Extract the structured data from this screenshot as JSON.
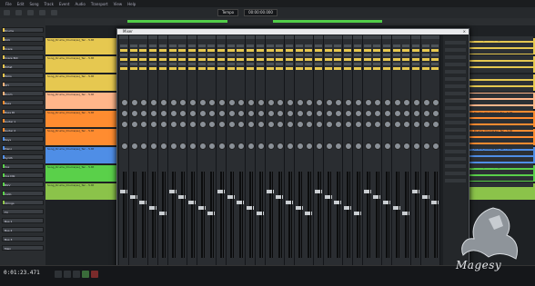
{
  "menu": {
    "items": [
      "File",
      "Edit",
      "Song",
      "Track",
      "Event",
      "Audio",
      "Transport",
      "View",
      "Help"
    ]
  },
  "toolbar": {
    "tempo_label": "Tempo",
    "time_display": "00:00:00.000"
  },
  "tracks": [
    {
      "name": "Drums",
      "color": "#e7c44c"
    },
    {
      "name": "Kick",
      "color": "#e7c44c"
    },
    {
      "name": "Snare",
      "color": "#e7c44c"
    },
    {
      "name": "Snare Bot",
      "color": "#e7c44c"
    },
    {
      "name": "HiHat",
      "color": "#e7c44c"
    },
    {
      "name": "Toms",
      "color": "#e7c44c"
    },
    {
      "name": "OH",
      "color": "#ffb07a"
    },
    {
      "name": "Room",
      "color": "#ffb07a"
    },
    {
      "name": "Bass",
      "color": "#ff8b2e"
    },
    {
      "name": "Bass DI",
      "color": "#ff8b2e"
    },
    {
      "name": "Guitar 1",
      "color": "#ff8b2e"
    },
    {
      "name": "Guitar 2",
      "color": "#ff8b2e"
    },
    {
      "name": "Keys",
      "color": "#4f8ee6"
    },
    {
      "name": "Piano",
      "color": "#4f8ee6"
    },
    {
      "name": "Synth",
      "color": "#4f8ee6"
    },
    {
      "name": "Vox",
      "color": "#5ad04a"
    },
    {
      "name": "Vox Dbl",
      "color": "#5ad04a"
    },
    {
      "name": "BGV",
      "color": "#5ad04a"
    },
    {
      "name": "Cello",
      "color": "#5ad04a"
    },
    {
      "name": "Strings",
      "color": "#8bc34a"
    },
    {
      "name": "FX",
      "color": "#3a3e43"
    },
    {
      "name": "Bus 1",
      "color": "#3a3e43"
    },
    {
      "name": "Bus 2",
      "color": "#3a3e43"
    },
    {
      "name": "Bus 3",
      "color": "#3a3e43"
    },
    {
      "name": "Main",
      "color": "#3a3e43"
    }
  ],
  "clips": [
    {
      "label": "Song_Drums_Drums(ss)_Tec - 5.8t",
      "color": "#e6c850"
    },
    {
      "label": "Song_Drums_Drums(ss)_Tec - 5.8t",
      "color": "#e6c850"
    },
    {
      "label": "Song_Drums_Drums(ss)_Tec - 5.8t",
      "color": "#e6c850"
    },
    {
      "label": "Song_Drums_Drums(ss)_Tec - 5.8t",
      "color": "#ffb68a"
    },
    {
      "label": "Song_Drums_Drums(ss)_Tec - 5.8t",
      "color": "#ff8c30"
    },
    {
      "label": "Song_Drums_Drums(ss)_Tec - 5.8t",
      "color": "#ff8c30"
    },
    {
      "label": "Song_Drums_Drums(ss)_Tec - 5.8t",
      "color": "#4f8ee6"
    },
    {
      "label": "Song_Drums_Drums(ss)_Tec - 5.8t",
      "color": "#5ad04a"
    },
    {
      "label": "Song_Drums_Drums(ss)_Tec - 5.8t",
      "color": "#8bc34a"
    }
  ],
  "mixer": {
    "title": "Mixer",
    "close": "×",
    "strip_labels": [
      "Kick",
      "Snare",
      "SnB",
      "HH",
      "Tom1",
      "Tom2",
      "OH",
      "Room",
      "Bass",
      "BDI",
      "Gtr1",
      "Gtr2",
      "Keys",
      "Pno",
      "Syn",
      "Vox",
      "VDb",
      "BGV",
      "Cel",
      "Str",
      "FX1",
      "FX2",
      "FX3",
      "Bus1",
      "Bus2",
      "Bus3",
      "Main",
      "Mon",
      "Out",
      "Cue",
      "Out2",
      "Out3",
      "Out4"
    ]
  },
  "transport": {
    "time": "0:01:23.471"
  },
  "logo": {
    "text": "Magesy"
  }
}
